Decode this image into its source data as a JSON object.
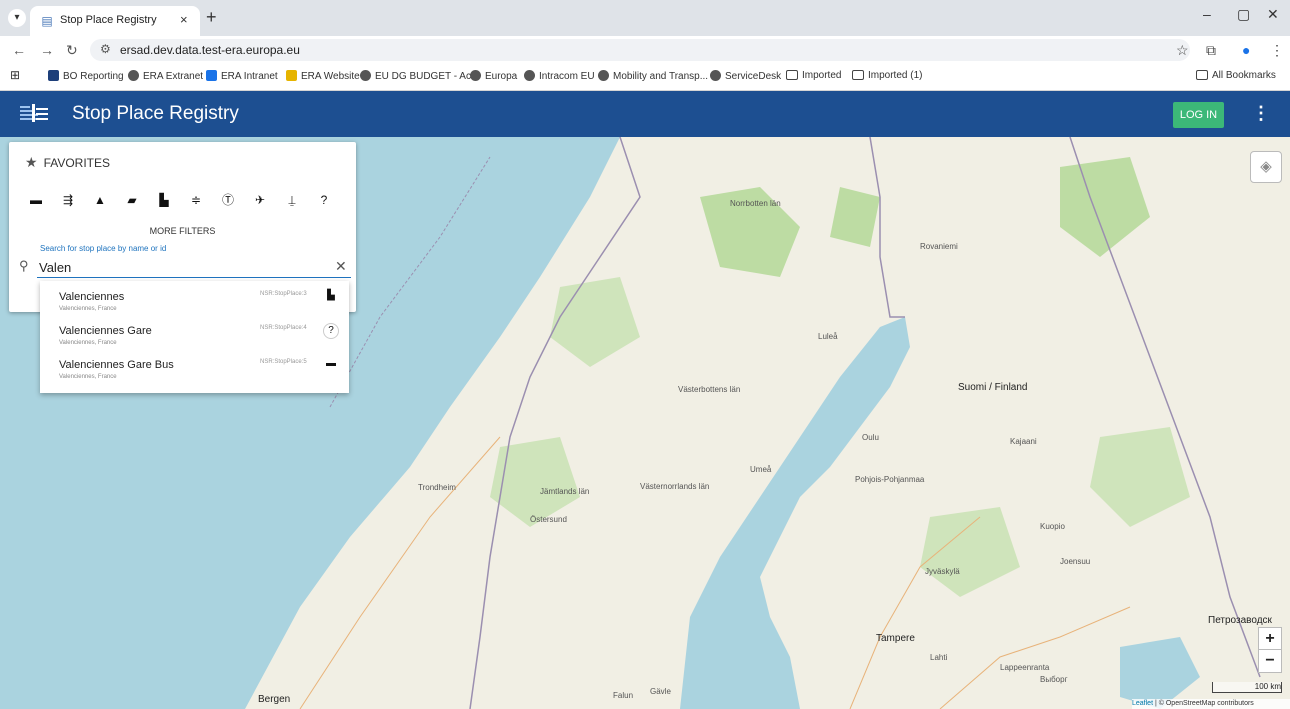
{
  "browser": {
    "tab_title": "Stop Place Registry",
    "tab_close": "×",
    "new_tab": "+",
    "url": "ersad.dev.data.test-era.europa.eu",
    "bookmarks": [
      {
        "label": "BO Reporting"
      },
      {
        "label": "ERA Extranet"
      },
      {
        "label": "ERA Intranet"
      },
      {
        "label": "ERA Website"
      },
      {
        "label": "EU DG BUDGET - Ac..."
      },
      {
        "label": "Europa"
      },
      {
        "label": "Intracom EU"
      },
      {
        "label": "Mobility and Transp..."
      },
      {
        "label": "ServiceDesk"
      },
      {
        "label": "Imported"
      },
      {
        "label": "Imported (1)"
      }
    ],
    "all_bookmarks": "All Bookmarks",
    "window_controls": [
      "–",
      "▢",
      "✕"
    ]
  },
  "app": {
    "title": "Stop Place Registry",
    "login_label": "LOG IN",
    "brand_color": "#1d4f91",
    "login_color": "#3cb878"
  },
  "panel": {
    "favorites_label": "FAVORITES",
    "more_filters_label": "MORE FILTERS",
    "search_hint": "Search for stop place by name or id",
    "search_value": "Valen",
    "transport_modes": [
      "bus-icon",
      "coach-icon",
      "tram-icon",
      "rail-icon",
      "ferry-icon",
      "cablecar-icon",
      "metro-icon",
      "air-icon",
      "funicular-icon",
      "unknown-icon"
    ]
  },
  "suggestions": [
    {
      "name": "Valenciennes",
      "subtitle": "Valenciennes, France",
      "id": "NSR:StopPlace:3",
      "icon": "ferry-icon"
    },
    {
      "name": "Valenciennes Gare",
      "subtitle": "Valenciennes, France",
      "id": "NSR:StopPlace:4",
      "icon": "unknown-icon"
    },
    {
      "name": "Valenciennes Gare Bus",
      "subtitle": "Valenciennes, France",
      "id": "NSR:StopPlace:5",
      "icon": "bus-icon"
    }
  ],
  "map": {
    "labels": [
      "Norrbotten län",
      "Rovaniemi",
      "Luleå",
      "Suomi / Finland",
      "Västerbottens län",
      "Umeå",
      "Trondheim",
      "Östersund",
      "Jämtlands län",
      "Västernorrlands län",
      "Pohjois-Pohjanmaa",
      "Jyväskylä",
      "Joensuu",
      "Tampere",
      "Lahti",
      "Lappeenranta",
      "Выборг",
      "Петрозаводск",
      "Bergen",
      "Falun",
      "Gävle",
      "Kuopio",
      "Oulu",
      "Kajaani"
    ],
    "scale_label": "100 km",
    "attribution_leaflet": "Leaflet",
    "attribution_osm": "© OpenStreetMap contributors"
  }
}
